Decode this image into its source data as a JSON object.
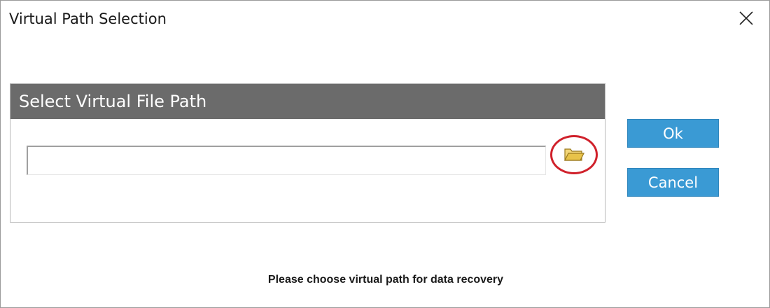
{
  "window": {
    "title": "Virtual Path Selection"
  },
  "panel": {
    "header": "Select Virtual File Path",
    "path_input_value": "",
    "browse_icon": "folder-open-icon"
  },
  "buttons": {
    "ok_label": "Ok",
    "cancel_label": "Cancel"
  },
  "hint": "Please choose virtual path for data recovery",
  "colors": {
    "header_bg": "#6b6b6b",
    "button_bg": "#3a9ad4",
    "highlight_circle": "#d0212b",
    "folder_icon": "#e8c34a"
  }
}
